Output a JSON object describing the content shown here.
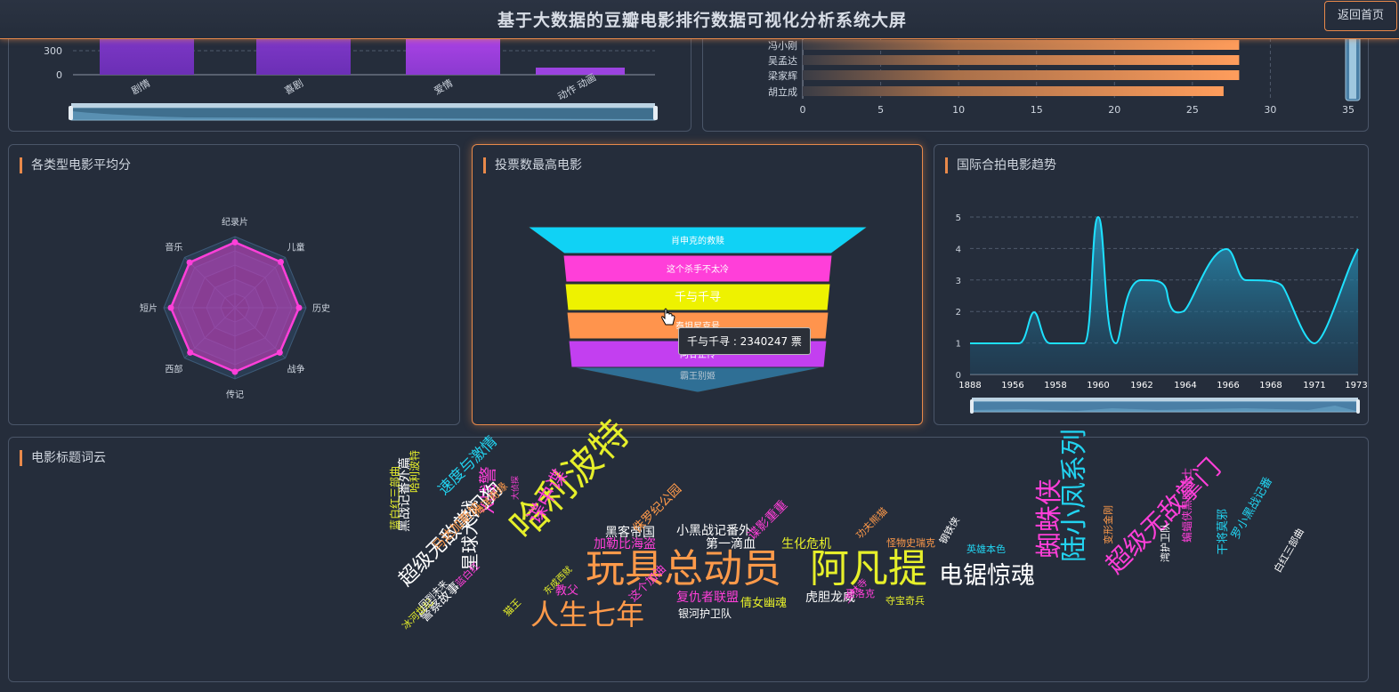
{
  "header": {
    "title": "基于大数据的豆瓣电影排行数据可视化分析系统大屏",
    "home_button": "返回首页"
  },
  "genre_bar": {
    "y_ticks": [
      "300",
      "0"
    ],
    "categories": [
      "剧情",
      "喜剧",
      "爱情",
      "动作 动画"
    ]
  },
  "director_bar": {
    "names": [
      "冯小刚",
      "吴孟达",
      "梁家辉",
      "胡立成"
    ],
    "values": [
      28,
      28,
      28,
      27
    ],
    "x_ticks": [
      "0",
      "5",
      "10",
      "15",
      "20",
      "25",
      "30",
      "35"
    ]
  },
  "radar": {
    "title": "各类型电影平均分",
    "axes": [
      "纪录片",
      "儿童",
      "历史",
      "战争",
      "传记",
      "西部",
      "短片",
      "音乐"
    ],
    "values": [
      0.92,
      0.91,
      0.9,
      0.89,
      0.9,
      0.89,
      0.9,
      0.9
    ]
  },
  "funnel": {
    "title": "投票数最高电影",
    "items": [
      "肖申克的救赎",
      "这个杀手不太冷",
      "千与千寻",
      "泰坦尼克号",
      "阿甘正传",
      "霸王别姬"
    ],
    "tooltip": "千与千寻 : 2340247 票"
  },
  "trend": {
    "title": "国际合拍电影趋势",
    "x_labels": [
      "1888",
      "1956",
      "1958",
      "1960",
      "1962",
      "1964",
      "1966",
      "1968",
      "1971",
      "1973"
    ],
    "y_ticks": [
      "0",
      "1",
      "2",
      "3",
      "4",
      "5"
    ]
  },
  "wordcloud": {
    "title": "电影标题词云",
    "words": [
      {
        "t": "玩具总动员",
        "c": "#ff9a4a"
      },
      {
        "t": "阿凡提",
        "c": "#e6ef2a"
      },
      {
        "t": "电锯惊魂",
        "c": "#ffffff"
      },
      {
        "t": "哈利波特",
        "c": "#e6ef2a"
      },
      {
        "t": "人生七年",
        "c": "#ff9a4a"
      },
      {
        "t": "蜘蛛侠",
        "c": "#ff3fd9"
      },
      {
        "t": "陆小凤系列",
        "c": "#22d3f0"
      },
      {
        "t": "超级无敌掌门",
        "c": "#ff3fd9"
      },
      {
        "t": "谍中谍",
        "c": "#ff3fd9"
      },
      {
        "t": "X战警",
        "c": "#ff3fd9"
      },
      {
        "t": "星球大战",
        "c": "#ffffff"
      },
      {
        "t": "超级无敌掌门狗",
        "c": "#ffffff"
      },
      {
        "t": "速度与激情",
        "c": "#22d3f0"
      },
      {
        "t": "黑客帝国",
        "c": "#ffffff"
      },
      {
        "t": "小黑战记番外",
        "c": "#ffffff"
      },
      {
        "t": "第一滴血",
        "c": "#ffffff"
      },
      {
        "t": "加勒比海盗",
        "c": "#ff3fd9"
      },
      {
        "t": "侏罗纪公园",
        "c": "#ff9a4a"
      },
      {
        "t": "谍影重重",
        "c": "#ff3fd9"
      },
      {
        "t": "生化危机",
        "c": "#e6ef2a"
      },
      {
        "t": "复仇者联盟",
        "c": "#ff3fd9"
      },
      {
        "t": "倩女幽魂",
        "c": "#e6ef2a"
      },
      {
        "t": "虎胆龙威",
        "c": "#ffffff"
      },
      {
        "t": "教父",
        "c": "#ff3fd9"
      },
      {
        "t": "这个加油",
        "c": "#ff3fd9"
      },
      {
        "t": "银河护卫队",
        "c": "#ffffff"
      },
      {
        "t": "怪物史瑞克",
        "c": "#ff9a4a"
      },
      {
        "t": "英雄本色",
        "c": "#22d3f0"
      },
      {
        "t": "夺宝奇兵",
        "c": "#e6ef2a"
      },
      {
        "t": "罗小黑战记番",
        "c": "#22d3f0"
      },
      {
        "t": "蝙蝠侠黑暗骑士",
        "c": "#ff3fd9"
      },
      {
        "t": "干将莫邪",
        "c": "#22d3f0"
      },
      {
        "t": "白红三部曲",
        "c": "#ffffff"
      },
      {
        "t": "黑战记番外篇",
        "c": "#ffffff"
      },
      {
        "t": "马达加斯加",
        "c": "#ff9a4a"
      },
      {
        "t": "警察故事",
        "c": "#ffffff"
      },
      {
        "t": "蓝白红三部曲",
        "c": "#e6ef2a"
      },
      {
        "t": "钢铁侠",
        "c": "#ffffff"
      },
      {
        "t": "功夫熊猫",
        "c": "#ff9a4a"
      },
      {
        "t": "哈利波特",
        "c": "#e6ef2a"
      },
      {
        "t": "海洋奇缘",
        "c": "#ff9a4a"
      },
      {
        "t": "猫王",
        "c": "#e6ef2a"
      },
      {
        "t": "冰河世纪",
        "c": "#e6ef2a"
      },
      {
        "t": "湾护卫队",
        "c": "#ffffff"
      },
      {
        "t": "变形金刚",
        "c": "#ff9a4a"
      },
      {
        "t": "蓝白红",
        "c": "#ff3fd9"
      },
      {
        "t": "东成西就",
        "c": "#e6ef2a"
      },
      {
        "t": "少林寺",
        "c": "#ff3fd9"
      },
      {
        "t": "回到未来",
        "c": "#ffffff"
      },
      {
        "t": "大侦探",
        "c": "#ff3fd9"
      },
      {
        "t": "夏洛克",
        "c": "#ff3fd9"
      }
    ]
  }
}
